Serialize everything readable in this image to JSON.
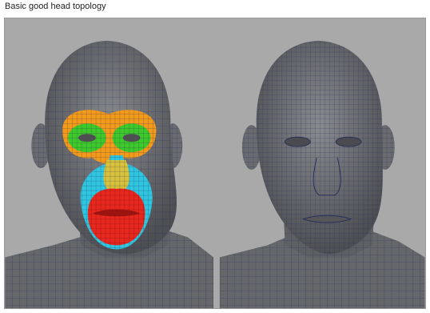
{
  "page": {
    "caption": "Basic good head topology"
  },
  "figure": {
    "background": "#a9a9a9",
    "mesh_color": "#6f7073",
    "wire_color": "#1f2a5c",
    "loop_colors": {
      "eye_socket": "#f39a1a",
      "eyes": "#3ec92a",
      "nose": "#d8c23c",
      "nasolabial": "#2fc6e0",
      "mouth": "#e8281f"
    }
  }
}
